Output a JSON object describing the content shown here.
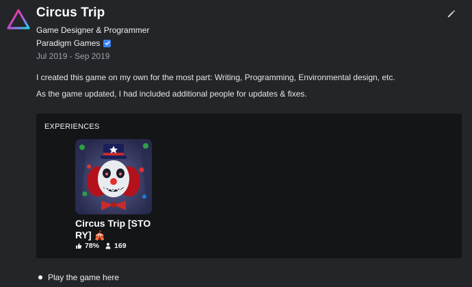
{
  "header": {
    "title": "Circus Trip",
    "role": "Game Designer & Programmer",
    "company": "Paradigm Games",
    "dates": "Jul 2019 - Sep 2019"
  },
  "description": {
    "para1": "I created this game on my own for the most part: Writing, Programming, Environmental design, etc.",
    "para2": "As the game updated, I had included additional people for updates & fixes."
  },
  "experiences": {
    "heading": "EXPERIENCES",
    "items": [
      {
        "title": "Circus Trip [STORY]",
        "emoji": "🎪",
        "likes": "78%",
        "players": "169"
      }
    ]
  },
  "links": {
    "play": "Play the game here"
  },
  "colors": {
    "background": "#232528",
    "panel": "#141517",
    "verified": "#3b82f6",
    "logo_gradient": [
      "#ff2a6d",
      "#c34bd6",
      "#22d3ee"
    ]
  },
  "icons": {
    "logo": "triangle-logo-icon",
    "edit": "pencil-icon",
    "verified": "verified-check-icon",
    "likes": "thumbs-up-icon",
    "players": "players-icon"
  }
}
